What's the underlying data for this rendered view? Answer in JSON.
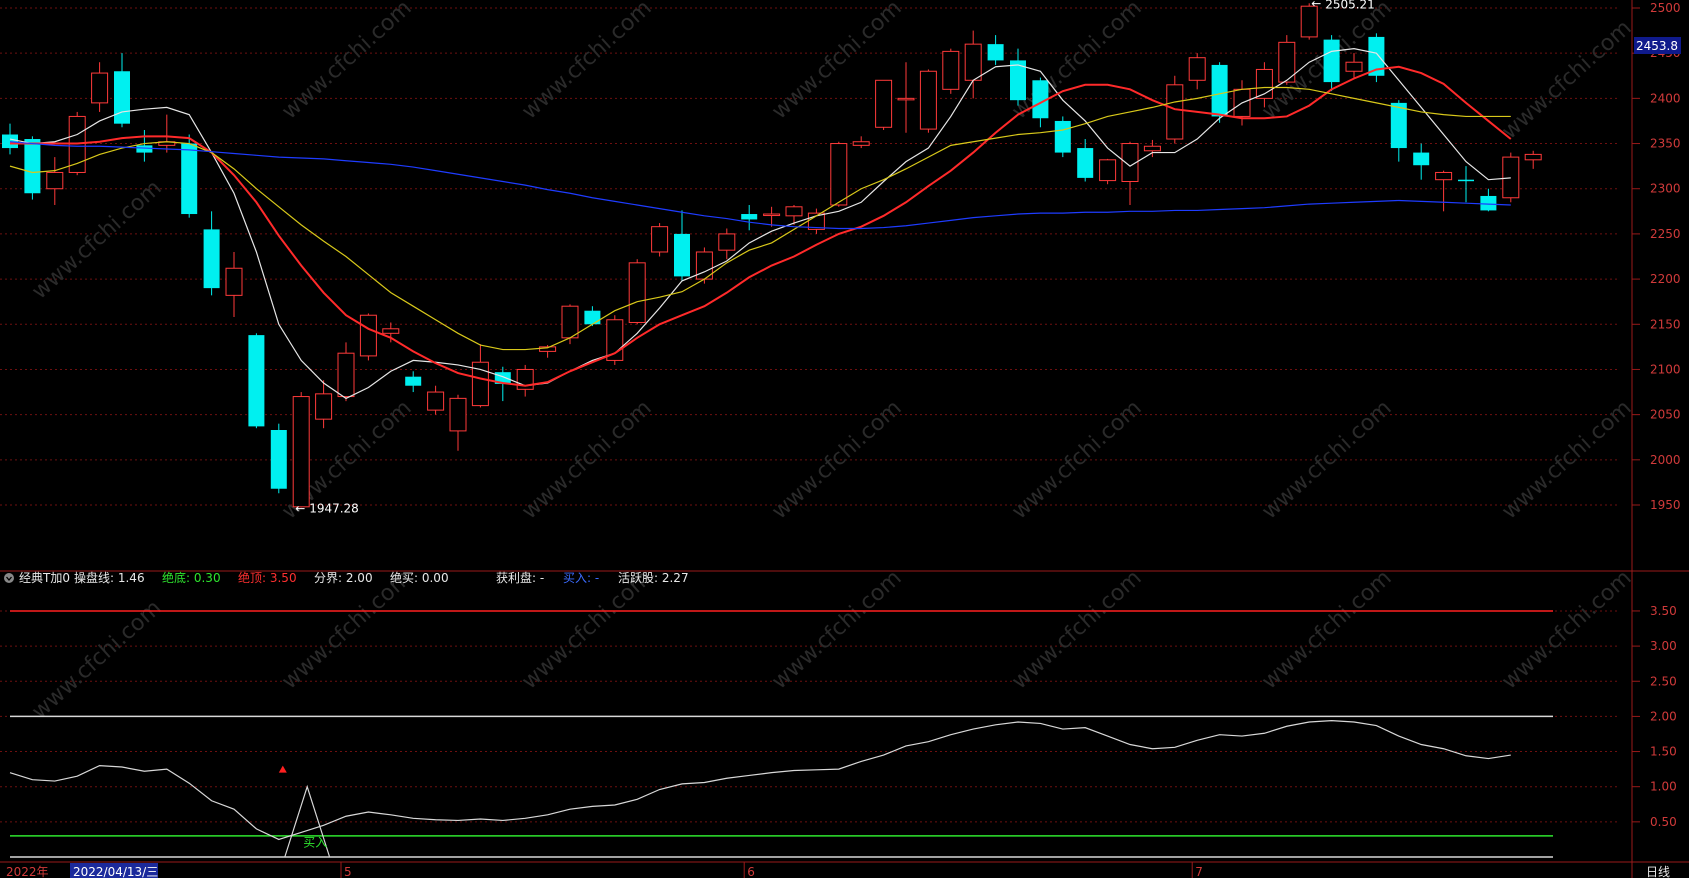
{
  "price_axis": {
    "ticks": [
      "2500",
      "2450",
      "2400",
      "2350",
      "2300",
      "2250",
      "2200",
      "2150",
      "2100",
      "2050",
      "2000",
      "1950"
    ],
    "current_price": "2453.8"
  },
  "price_annotations": {
    "high": "2505.21",
    "low": "1947.28"
  },
  "indicator": {
    "name": "经典T加0",
    "params": [
      {
        "label": "操盘线:",
        "value": "1.46",
        "color": "#e8e8e8"
      },
      {
        "label": "绝底:",
        "value": "0.30",
        "color": "#2ee52e"
      },
      {
        "label": "绝顶:",
        "value": "3.50",
        "color": "#ff3030"
      },
      {
        "label": "分界:",
        "value": "2.00",
        "color": "#e8e8e8"
      },
      {
        "label": "绝买:",
        "value": "0.00",
        "color": "#e8e8e8"
      },
      {
        "label": "获利盘:",
        "value": "-",
        "color": "#e8e8e8"
      },
      {
        "label": "买入:",
        "value": "-",
        "color": "#3b6bff"
      },
      {
        "label": "活跃股:",
        "value": "2.27",
        "color": "#e8e8e8"
      }
    ],
    "ticks": [
      "3.50",
      "3.00",
      "2.50",
      "2.00",
      "1.50",
      "1.00",
      "0.50"
    ],
    "buy_signal": "买入"
  },
  "time_axis": {
    "year": "2022年",
    "cursor_date": "2022/04/13/三",
    "months": [
      "5",
      "6",
      "7"
    ],
    "period": "日线"
  },
  "watermark": "www.cfchi.com",
  "chart_data": [
    {
      "type": "candlestick",
      "series_name": "",
      "ylim": [
        1925,
        2505
      ],
      "yticks": [
        1950,
        2000,
        2050,
        2100,
        2150,
        2200,
        2250,
        2300,
        2350,
        2400,
        2450,
        2500
      ],
      "candles": [
        {
          "o": 2360,
          "h": 2372,
          "l": 2338,
          "c": 2345
        },
        {
          "o": 2355,
          "h": 2358,
          "l": 2288,
          "c": 2295
        },
        {
          "o": 2300,
          "h": 2335,
          "l": 2282,
          "c": 2318
        },
        {
          "o": 2318,
          "h": 2385,
          "l": 2315,
          "c": 2380
        },
        {
          "o": 2395,
          "h": 2440,
          "l": 2385,
          "c": 2428
        },
        {
          "o": 2430,
          "h": 2450,
          "l": 2368,
          "c": 2372
        },
        {
          "o": 2348,
          "h": 2365,
          "l": 2330,
          "c": 2340
        },
        {
          "o": 2348,
          "h": 2382,
          "l": 2340,
          "c": 2352
        },
        {
          "o": 2350,
          "h": 2360,
          "l": 2268,
          "c": 2272
        },
        {
          "o": 2255,
          "h": 2275,
          "l": 2182,
          "c": 2190
        },
        {
          "o": 2182,
          "h": 2230,
          "l": 2158,
          "c": 2212
        },
        {
          "o": 2138,
          "h": 2140,
          "l": 2035,
          "c": 2037
        },
        {
          "o": 2033,
          "h": 2040,
          "l": 1963,
          "c": 1968
        },
        {
          "o": 1948,
          "h": 2075,
          "l": 1947.28,
          "c": 2070
        },
        {
          "o": 2045,
          "h": 2088,
          "l": 2035,
          "c": 2073
        },
        {
          "o": 2070,
          "h": 2130,
          "l": 2065,
          "c": 2118
        },
        {
          "o": 2115,
          "h": 2162,
          "l": 2110,
          "c": 2160
        },
        {
          "o": 2140,
          "h": 2152,
          "l": 2130,
          "c": 2145
        },
        {
          "o": 2092,
          "h": 2098,
          "l": 2075,
          "c": 2082
        },
        {
          "o": 2055,
          "h": 2082,
          "l": 2050,
          "c": 2075
        },
        {
          "o": 2032,
          "h": 2072,
          "l": 2010,
          "c": 2068
        },
        {
          "o": 2060,
          "h": 2128,
          "l": 2058,
          "c": 2108
        },
        {
          "o": 2097,
          "h": 2103,
          "l": 2065,
          "c": 2084
        },
        {
          "o": 2078,
          "h": 2105,
          "l": 2070,
          "c": 2100
        },
        {
          "o": 2120,
          "h": 2127,
          "l": 2113,
          "c": 2125
        },
        {
          "o": 2135,
          "h": 2172,
          "l": 2128,
          "c": 2170
        },
        {
          "o": 2165,
          "h": 2170,
          "l": 2148,
          "c": 2150
        },
        {
          "o": 2110,
          "h": 2160,
          "l": 2105,
          "c": 2155
        },
        {
          "o": 2152,
          "h": 2222,
          "l": 2150,
          "c": 2218
        },
        {
          "o": 2230,
          "h": 2262,
          "l": 2225,
          "c": 2258
        },
        {
          "o": 2250,
          "h": 2276,
          "l": 2198,
          "c": 2203
        },
        {
          "o": 2200,
          "h": 2235,
          "l": 2195,
          "c": 2230
        },
        {
          "o": 2232,
          "h": 2256,
          "l": 2222,
          "c": 2250
        },
        {
          "o": 2272,
          "h": 2282,
          "l": 2254,
          "c": 2266
        },
        {
          "o": 2272,
          "h": 2280,
          "l": 2258,
          "c": 2272
        },
        {
          "o": 2270,
          "h": 2282,
          "l": 2260,
          "c": 2280
        },
        {
          "o": 2255,
          "h": 2278,
          "l": 2250,
          "c": 2273
        },
        {
          "o": 2282,
          "h": 2352,
          "l": 2280,
          "c": 2350
        },
        {
          "o": 2348,
          "h": 2358,
          "l": 2345,
          "c": 2352
        },
        {
          "o": 2368,
          "h": 2420,
          "l": 2365,
          "c": 2420
        },
        {
          "o": 2400,
          "h": 2440,
          "l": 2362,
          "c": 2400
        },
        {
          "o": 2366,
          "h": 2432,
          "l": 2362,
          "c": 2430
        },
        {
          "o": 2410,
          "h": 2455,
          "l": 2405,
          "c": 2452
        },
        {
          "o": 2420,
          "h": 2475,
          "l": 2400,
          "c": 2460
        },
        {
          "o": 2460,
          "h": 2470,
          "l": 2437,
          "c": 2442
        },
        {
          "o": 2442,
          "h": 2455,
          "l": 2392,
          "c": 2398
        },
        {
          "o": 2420,
          "h": 2423,
          "l": 2368,
          "c": 2378
        },
        {
          "o": 2375,
          "h": 2380,
          "l": 2335,
          "c": 2340
        },
        {
          "o": 2345,
          "h": 2355,
          "l": 2308,
          "c": 2312
        },
        {
          "o": 2309,
          "h": 2333,
          "l": 2305,
          "c": 2332
        },
        {
          "o": 2308,
          "h": 2352,
          "l": 2282,
          "c": 2350
        },
        {
          "o": 2342,
          "h": 2354,
          "l": 2335,
          "c": 2347
        },
        {
          "o": 2355,
          "h": 2425,
          "l": 2350,
          "c": 2415
        },
        {
          "o": 2420,
          "h": 2450,
          "l": 2410,
          "c": 2445
        },
        {
          "o": 2437,
          "h": 2440,
          "l": 2373,
          "c": 2380
        },
        {
          "o": 2380,
          "h": 2420,
          "l": 2370,
          "c": 2410
        },
        {
          "o": 2400,
          "h": 2440,
          "l": 2390,
          "c": 2432
        },
        {
          "o": 2418,
          "h": 2470,
          "l": 2415,
          "c": 2462
        },
        {
          "o": 2468,
          "h": 2505.21,
          "l": 2465,
          "c": 2502
        },
        {
          "o": 2465,
          "h": 2470,
          "l": 2408,
          "c": 2418
        },
        {
          "o": 2430,
          "h": 2450,
          "l": 2422,
          "c": 2440
        },
        {
          "o": 2468,
          "h": 2472,
          "l": 2418,
          "c": 2425
        },
        {
          "o": 2395,
          "h": 2398,
          "l": 2330,
          "c": 2345
        },
        {
          "o": 2340,
          "h": 2350,
          "l": 2310,
          "c": 2326
        },
        {
          "o": 2310,
          "h": 2320,
          "l": 2275,
          "c": 2318
        },
        {
          "o": 2310,
          "h": 2325,
          "l": 2285,
          "c": 2309
        },
        {
          "o": 2292,
          "h": 2300,
          "l": 2275,
          "c": 2276
        },
        {
          "o": 2290,
          "h": 2340,
          "l": 2285,
          "c": 2335
        },
        {
          "o": 2332,
          "h": 2342,
          "l": 2322,
          "c": 2338
        }
      ],
      "moving_averages": [
        {
          "color": "#e6e6e6",
          "values": [
            2355,
            2350,
            2352,
            2360,
            2375,
            2385,
            2388,
            2390,
            2382,
            2340,
            2295,
            2230,
            2150,
            2110,
            2085,
            2068,
            2080,
            2098,
            2110,
            2108,
            2105,
            2100,
            2092,
            2082,
            2085,
            2098,
            2110,
            2118,
            2140,
            2168,
            2198,
            2208,
            2220,
            2240,
            2253,
            2262,
            2270,
            2275,
            2285,
            2308,
            2330,
            2345,
            2380,
            2420,
            2435,
            2437,
            2430,
            2398,
            2375,
            2345,
            2325,
            2340,
            2340,
            2355,
            2378,
            2395,
            2405,
            2420,
            2440,
            2452,
            2455,
            2450,
            2420,
            2390,
            2360,
            2330,
            2310,
            2312
          ]
        },
        {
          "color": "#ff2a2a",
          "values": [
            2350,
            2350,
            2350,
            2350,
            2352,
            2356,
            2358,
            2358,
            2356,
            2340,
            2315,
            2285,
            2248,
            2215,
            2185,
            2160,
            2145,
            2135,
            2120,
            2107,
            2096,
            2090,
            2085,
            2082,
            2086,
            2098,
            2108,
            2118,
            2135,
            2150,
            2160,
            2170,
            2185,
            2202,
            2215,
            2225,
            2238,
            2250,
            2258,
            2270,
            2285,
            2303,
            2320,
            2340,
            2362,
            2382,
            2395,
            2408,
            2415,
            2415,
            2410,
            2398,
            2388,
            2385,
            2382,
            2378,
            2378,
            2380,
            2392,
            2410,
            2422,
            2432,
            2435,
            2428,
            2416,
            2395,
            2375,
            2355
          ]
        },
        {
          "color": "#d8c81a",
          "values": [
            2325,
            2318,
            2320,
            2328,
            2338,
            2345,
            2350,
            2352,
            2350,
            2340,
            2322,
            2300,
            2280,
            2260,
            2242,
            2225,
            2205,
            2185,
            2170,
            2155,
            2140,
            2127,
            2122,
            2122,
            2124,
            2135,
            2150,
            2165,
            2175,
            2180,
            2186,
            2200,
            2218,
            2232,
            2240,
            2255,
            2270,
            2285,
            2300,
            2310,
            2322,
            2335,
            2348,
            2352,
            2356,
            2360,
            2362,
            2365,
            2372,
            2380,
            2385,
            2390,
            2396,
            2400,
            2405,
            2410,
            2412,
            2412,
            2410,
            2405,
            2400,
            2395,
            2390,
            2385,
            2382,
            2380,
            2380,
            2380
          ]
        },
        {
          "color": "#1e3cff",
          "values": [
            2352,
            2350,
            2348,
            2347,
            2347,
            2346,
            2345,
            2344,
            2343,
            2341,
            2339,
            2337,
            2335,
            2334,
            2333,
            2331,
            2329,
            2327,
            2324,
            2320,
            2316,
            2312,
            2308,
            2304,
            2299,
            2295,
            2290,
            2286,
            2282,
            2278,
            2274,
            2270,
            2267,
            2263,
            2260,
            2258,
            2257,
            2256,
            2256,
            2257,
            2259,
            2262,
            2265,
            2268,
            2270,
            2272,
            2273,
            2273,
            2274,
            2274,
            2275,
            2275,
            2276,
            2276,
            2277,
            2278,
            2279,
            2281,
            2283,
            2284,
            2285,
            2286,
            2287,
            2286,
            2285,
            2284,
            2283,
            2282
          ]
        }
      ]
    },
    {
      "type": "line",
      "series_name": "",
      "ylim": [
        0,
        4.2
      ],
      "yticks": [
        0.5,
        1.0,
        1.5,
        2.0,
        2.5,
        3.0,
        3.5
      ],
      "reference_lines": [
        {
          "value": 3.5,
          "color": "#ff2020"
        },
        {
          "value": 2.0,
          "color": "#d8d8d8"
        },
        {
          "value": 0.3,
          "color": "#2ee52e"
        },
        {
          "value": 0.0,
          "color": "#d8d8d8"
        }
      ],
      "operating_line": [
        1.2,
        1.1,
        1.08,
        1.15,
        1.3,
        1.28,
        1.22,
        1.25,
        1.05,
        0.8,
        0.68,
        0.4,
        0.25,
        0.35,
        0.45,
        0.58,
        0.64,
        0.6,
        0.55,
        0.53,
        0.52,
        0.54,
        0.52,
        0.55,
        0.6,
        0.68,
        0.72,
        0.74,
        0.82,
        0.96,
        1.04,
        1.06,
        1.12,
        1.16,
        1.2,
        1.23,
        1.24,
        1.25,
        1.36,
        1.45,
        1.58,
        1.64,
        1.74,
        1.82,
        1.88,
        1.92,
        1.9,
        1.82,
        1.84,
        1.72,
        1.6,
        1.54,
        1.56,
        1.66,
        1.74,
        1.72,
        1.76,
        1.86,
        1.92,
        1.94,
        1.92,
        1.87,
        1.72,
        1.6,
        1.54,
        1.44,
        1.4,
        1.45
      ],
      "buy_spike": [
        {
          "index": 12,
          "value": 0
        },
        {
          "index": 13,
          "value": 1.0
        },
        {
          "index": 14,
          "value": 0
        }
      ],
      "buy_marker_index": 12
    }
  ]
}
